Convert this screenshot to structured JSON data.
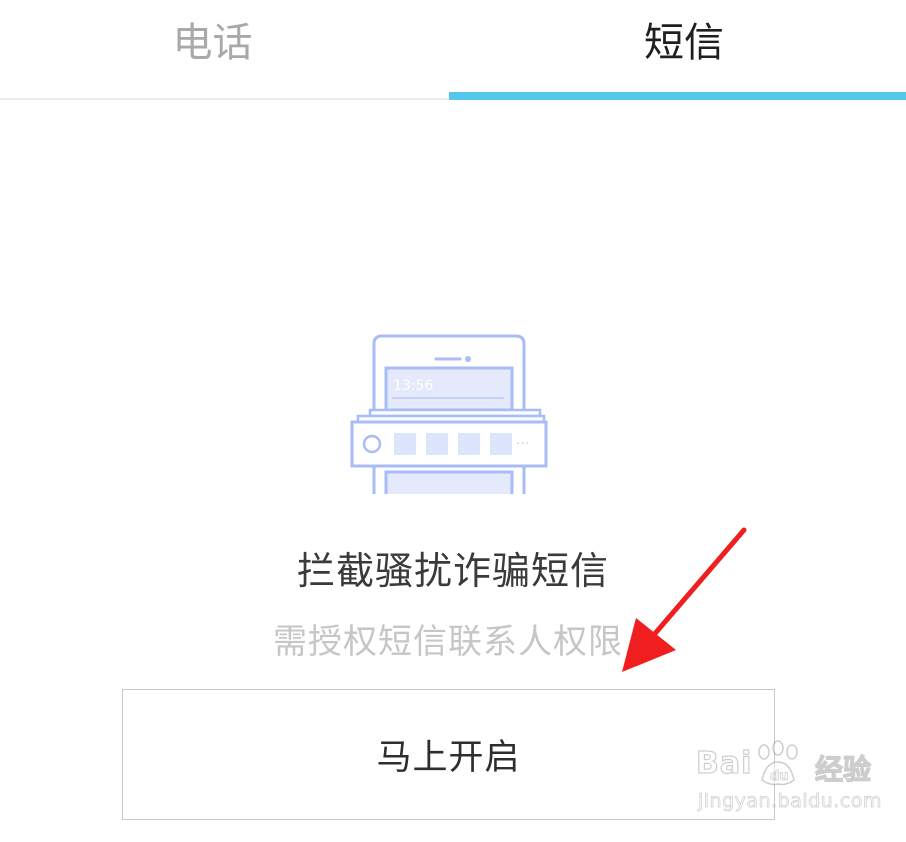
{
  "tabs": [
    {
      "label": "电话",
      "active": false
    },
    {
      "label": "短信",
      "active": true
    }
  ],
  "colors": {
    "accent": "#56c6ec",
    "illustration_stroke": "#a8bcf6",
    "illustration_fill": "#e4eafc",
    "annotation_arrow": "#f01e1e"
  },
  "illustration": {
    "icon": "phone-sms-filter-illustration",
    "clock_time": "13:56",
    "more_glyph": "···"
  },
  "main": {
    "title": "拦截骚扰诈骗短信",
    "subtitle": "需授权短信联系人权限",
    "button_label": "马上开启"
  },
  "annotation": {
    "icon": "red-arrow-pointer"
  },
  "watermark": {
    "brand": "Bai",
    "brand_suffix": "",
    "product": "经验",
    "url": "jingyan.baidu.com"
  }
}
